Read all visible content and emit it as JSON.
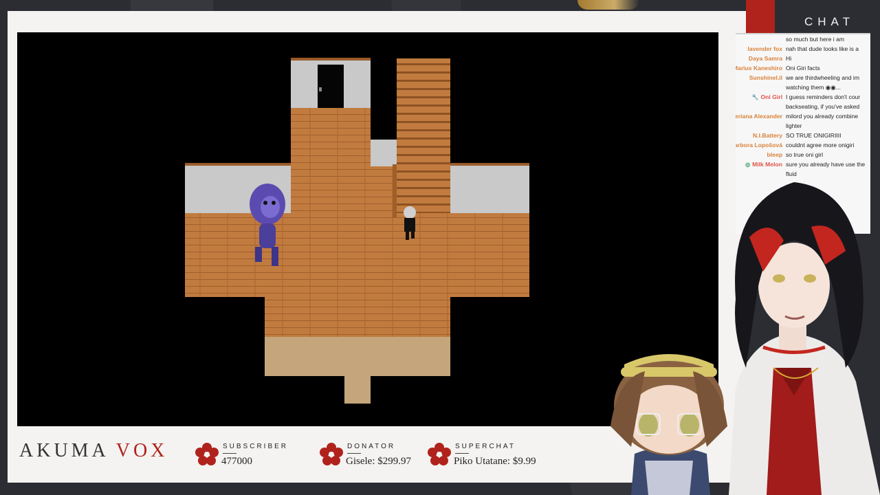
{
  "chat": {
    "title": "CHAT",
    "messages": [
      {
        "user": "",
        "text": "so much but here i am",
        "color": "#d9823a"
      },
      {
        "user": "lavender fox",
        "text": "nah that dude looks like is a",
        "color": "#d9823a"
      },
      {
        "user": "Daya Samra",
        "text": "Hi",
        "color": "#d9823a"
      },
      {
        "user": "Marius Kaneshiro",
        "text": "Oni Giri facts",
        "color": "#d9823a"
      },
      {
        "user": "Sunshinel.il",
        "text": "we are thirdwheeling and im watching them ◉◉...",
        "color": "#d9823a"
      },
      {
        "user": "Oni Girl",
        "text": "I guess reminders don't cour backseating, if you've asked",
        "color": "#e0554a"
      },
      {
        "user": "Meriana Alexander",
        "text": "milord you already combine lighter",
        "color": "#d9823a"
      },
      {
        "user": "N.I.Battery",
        "text": "SO TRUE ONIGIRIIII",
        "color": "#d9823a"
      },
      {
        "user": "Barbora Lopošová",
        "text": "couldnt agree more onigiri",
        "color": "#d9823a"
      },
      {
        "user": "bleep",
        "text": "so true oni girl",
        "color": "#d9823a"
      },
      {
        "user": "Milk Melon",
        "text": "sure you already have use the fluid",
        "color": "#e0554a"
      }
    ]
  },
  "brand": {
    "name_left": "AKUMA",
    "name_right": "VOX"
  },
  "stats": {
    "subscriber": {
      "label": "SUBSCRIBER",
      "value": "477000"
    },
    "donator": {
      "label": "DONATOR",
      "value": "Gisele: $299.97"
    },
    "superchat": {
      "label": "SUPERCHAT",
      "value": "Piko Utatane: $9.99"
    }
  },
  "colors": {
    "accent": "#b0221c",
    "frame": "#f4f3f1",
    "floor": "#c07a3e"
  }
}
